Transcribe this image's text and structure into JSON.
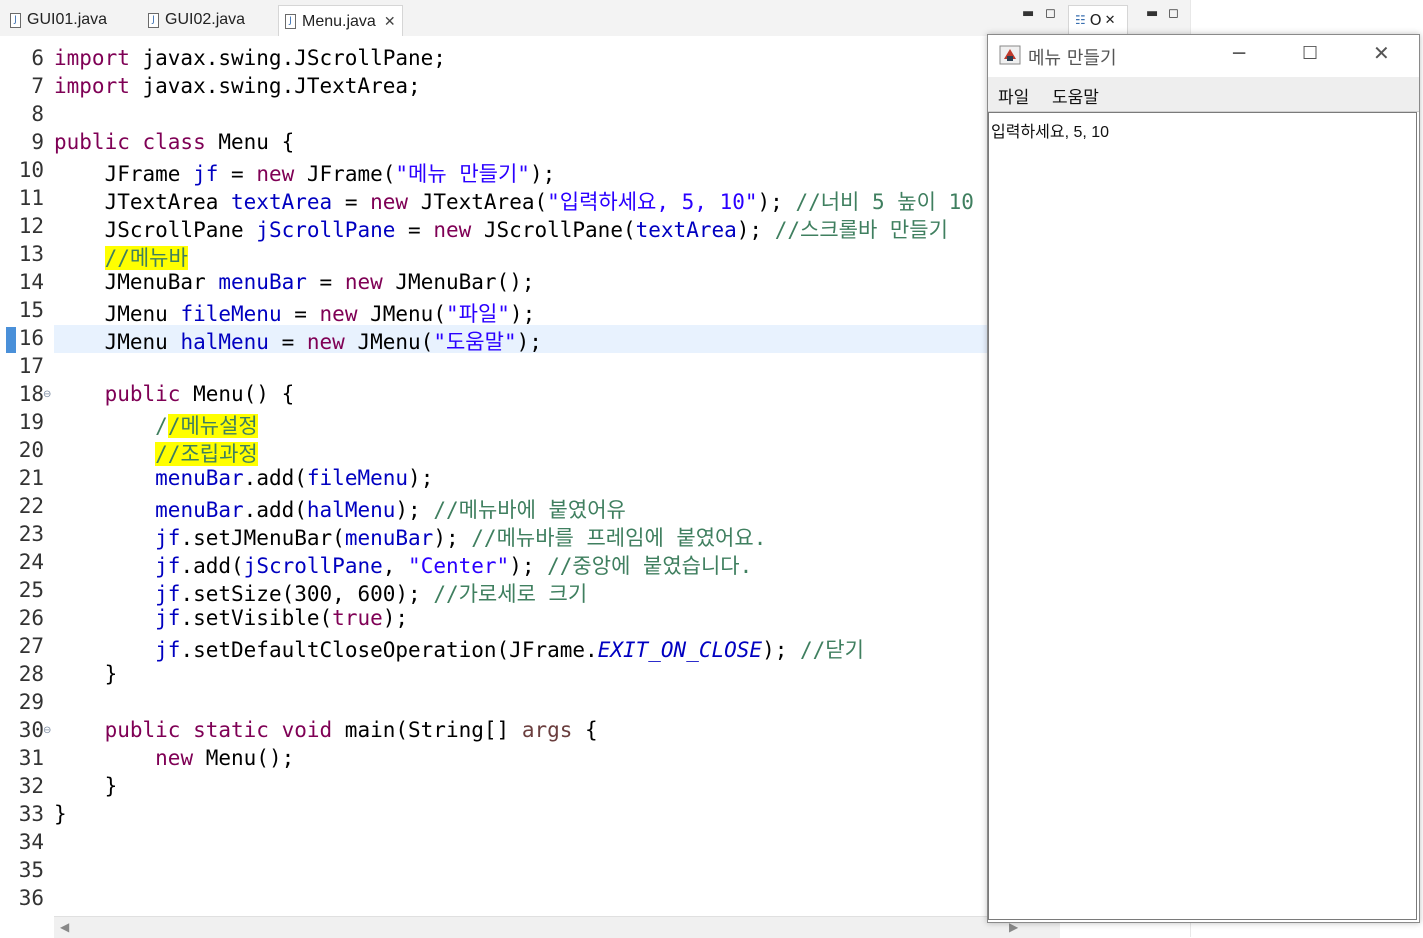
{
  "tabs": [
    {
      "label": "GUI01.java"
    },
    {
      "label": "GUI02.java"
    },
    {
      "label": "Menu.java"
    }
  ],
  "outline_tab": {
    "label": "O"
  },
  "code_lines": [
    {
      "n": "6",
      "segs": [
        [
          "kw",
          "import"
        ],
        [
          "",
          "javax.swing.JScrollPane;"
        ]
      ]
    },
    {
      "n": "7",
      "segs": [
        [
          "kw",
          "import"
        ],
        [
          "",
          "javax.swing.JTextArea;"
        ]
      ]
    }
  ],
  "java_frame": {
    "title": "메뉴 만들기",
    "menus": [
      "파일",
      "도움말"
    ],
    "textarea_text": "입력하세요, 5, 10"
  }
}
